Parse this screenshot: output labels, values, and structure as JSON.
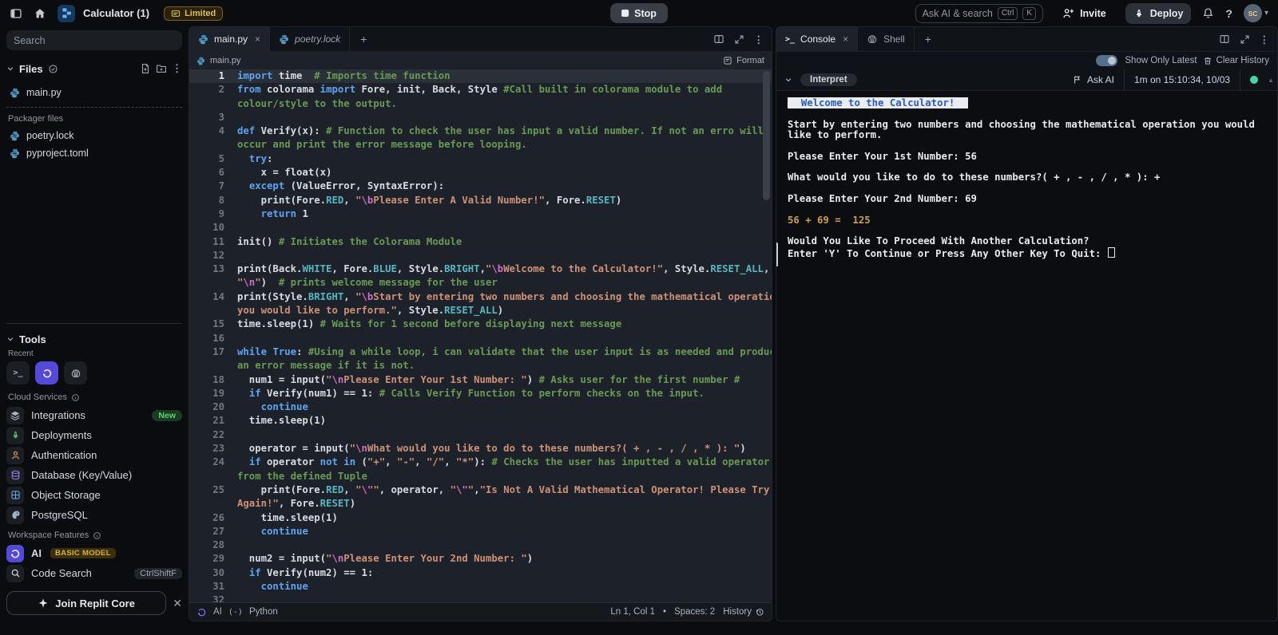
{
  "topbar": {
    "title": "Calculator (1)",
    "limited_badge": "Limited",
    "stop_label": "Stop",
    "search_placeholder": "Ask AI & search",
    "search_keys": [
      "Ctrl",
      "K"
    ],
    "invite_label": "Invite",
    "deploy_label": "Deploy",
    "avatar_initials": "SC"
  },
  "sidebar": {
    "search_placeholder": "Search",
    "files_header": "Files",
    "files": [
      {
        "icon": "python-icon",
        "name": "main.py"
      }
    ],
    "packager_label": "Packager files",
    "packager_files": [
      {
        "icon": "python-icon",
        "name": "poetry.lock"
      },
      {
        "icon": "python-icon",
        "name": "pyproject.toml"
      }
    ],
    "tools_header": "Tools",
    "recent_label": "Recent",
    "recent_tools": [
      {
        "icon": "terminal-icon",
        "active": false
      },
      {
        "icon": "ai-icon",
        "active": true
      },
      {
        "icon": "shell-icon",
        "active": false
      }
    ],
    "cloud_label": "Cloud Services",
    "cloud_items": [
      {
        "icon": "integrations-icon",
        "label": "Integrations",
        "badge": "New"
      },
      {
        "icon": "deployments-icon",
        "label": "Deployments"
      },
      {
        "icon": "authentication-icon",
        "label": "Authentication"
      },
      {
        "icon": "database-icon",
        "label": "Database (Key/Value)"
      },
      {
        "icon": "object-storage-icon",
        "label": "Object Storage"
      },
      {
        "icon": "postgresql-icon",
        "label": "PostgreSQL"
      }
    ],
    "workspace_label": "Workspace Features",
    "workspace_items": [
      {
        "icon": "ai-icon",
        "label": "AI",
        "badge": "BASIC MODEL"
      },
      {
        "icon": "code-search-icon",
        "label": "Code Search",
        "shortcut": "CtrlShiftF"
      }
    ],
    "join_core_label": "Join Replit Core"
  },
  "editor": {
    "tabs": [
      {
        "icon": "python-icon",
        "label": "main.py",
        "active": true,
        "close": true
      },
      {
        "icon": "python-icon",
        "label": "poetry.lock",
        "italic": true
      }
    ],
    "breadcrumb": "main.py",
    "format_label": "Format",
    "status": {
      "ai_label": "AI",
      "lang_glyph": "(-)",
      "language": "Python",
      "position": "Ln 1, Col 1",
      "spaces": "Spaces: 2",
      "history_label": "History"
    },
    "lines": [
      {
        "n": 1,
        "active": true,
        "segs": [
          [
            "kw",
            "import"
          ],
          [
            "pl",
            " time"
          ],
          [
            "cm",
            "  # Imports time function"
          ]
        ]
      },
      {
        "n": 2,
        "segs": [
          [
            "kw",
            "from"
          ],
          [
            "pl",
            " colorama "
          ],
          [
            "kw",
            "import"
          ],
          [
            "pl",
            " Fore, init, Back, Style "
          ],
          [
            "cm",
            "#Call built in colorama module to add"
          ]
        ]
      },
      {
        "n": null,
        "segs": [
          [
            "cm",
            "colour/style to the output."
          ]
        ]
      },
      {
        "n": 3,
        "segs": []
      },
      {
        "n": 4,
        "segs": [
          [
            "kw",
            "def"
          ],
          [
            "pl",
            " Verify(x): "
          ],
          [
            "cm",
            "# Function to check the user has input a valid number. If not an erro will"
          ]
        ]
      },
      {
        "n": null,
        "segs": [
          [
            "cm",
            "occur and print the error message before looping."
          ]
        ]
      },
      {
        "n": 5,
        "segs": [
          [
            "pl",
            "  "
          ],
          [
            "kw",
            "try"
          ],
          [
            "pl",
            ":"
          ]
        ]
      },
      {
        "n": 6,
        "segs": [
          [
            "pl",
            "    x = float(x)"
          ]
        ]
      },
      {
        "n": 7,
        "segs": [
          [
            "pl",
            "  "
          ],
          [
            "kw",
            "except"
          ],
          [
            "pl",
            " (ValueError, SyntaxError):"
          ]
        ]
      },
      {
        "n": 8,
        "segs": [
          [
            "pl",
            "    print(Fore."
          ],
          [
            "cn",
            "RED"
          ],
          [
            "pl",
            ", "
          ],
          [
            "st",
            "\""
          ],
          [
            "es",
            "\\b"
          ],
          [
            "st",
            "Please Enter A Valid Number!\""
          ],
          [
            "pl",
            ", Fore."
          ],
          [
            "cn",
            "RESET"
          ],
          [
            "pl",
            ")"
          ]
        ]
      },
      {
        "n": 9,
        "segs": [
          [
            "pl",
            "    "
          ],
          [
            "kw",
            "return"
          ],
          [
            "pl",
            " 1"
          ]
        ]
      },
      {
        "n": 10,
        "segs": []
      },
      {
        "n": 11,
        "segs": [
          [
            "pl",
            "init() "
          ],
          [
            "cm",
            "# Initiates the Colorama Module"
          ]
        ]
      },
      {
        "n": 12,
        "segs": []
      },
      {
        "n": 13,
        "segs": [
          [
            "pl",
            "print(Back."
          ],
          [
            "cn",
            "WHITE"
          ],
          [
            "pl",
            ", Fore."
          ],
          [
            "cn",
            "BLUE"
          ],
          [
            "pl",
            ", Style."
          ],
          [
            "cn",
            "BRIGHT"
          ],
          [
            "pl",
            ","
          ],
          [
            "st",
            "\""
          ],
          [
            "es",
            "\\b"
          ],
          [
            "st",
            "Welcome to the Calculator!\""
          ],
          [
            "pl",
            ", Style."
          ],
          [
            "cn",
            "RESET_ALL"
          ],
          [
            "pl",
            ","
          ]
        ]
      },
      {
        "n": null,
        "segs": [
          [
            "st",
            "\""
          ],
          [
            "es",
            "\\n"
          ],
          [
            "st",
            "\""
          ],
          [
            "pl",
            ")  "
          ],
          [
            "cm",
            "# prints welcome message for the user"
          ]
        ]
      },
      {
        "n": 14,
        "segs": [
          [
            "pl",
            "print(Style."
          ],
          [
            "cn",
            "BRIGHT"
          ],
          [
            "pl",
            ", "
          ],
          [
            "st",
            "\""
          ],
          [
            "es",
            "\\b"
          ],
          [
            "st",
            "Start by entering two numbers and choosing the mathematical operation"
          ]
        ]
      },
      {
        "n": null,
        "segs": [
          [
            "st",
            "you would like to perform.\""
          ],
          [
            "pl",
            ", Style."
          ],
          [
            "cn",
            "RESET_ALL"
          ],
          [
            "pl",
            ")"
          ]
        ]
      },
      {
        "n": 15,
        "segs": [
          [
            "pl",
            "time.sleep(1) "
          ],
          [
            "cm",
            "# Waits for 1 second before displaying next message"
          ]
        ]
      },
      {
        "n": 16,
        "segs": []
      },
      {
        "n": 17,
        "segs": [
          [
            "kw",
            "while"
          ],
          [
            "pl",
            " "
          ],
          [
            "kw",
            "True"
          ],
          [
            "pl",
            ": "
          ],
          [
            "cm",
            "#Using a while loop, i can validate that the user input is as needed and produce"
          ]
        ]
      },
      {
        "n": null,
        "segs": [
          [
            "cm",
            "an error message if it is not."
          ]
        ]
      },
      {
        "n": 18,
        "segs": [
          [
            "pl",
            "  num1 = input("
          ],
          [
            "st",
            "\""
          ],
          [
            "es",
            "\\n"
          ],
          [
            "st",
            "Please Enter Your 1st Number: \""
          ],
          [
            "pl",
            ") "
          ],
          [
            "cm",
            "# Asks user for the first number #"
          ]
        ]
      },
      {
        "n": 19,
        "segs": [
          [
            "pl",
            "  "
          ],
          [
            "kw",
            "if"
          ],
          [
            "pl",
            " Verify(num1) == 1: "
          ],
          [
            "cm",
            "# Calls Verify Function to perform checks on the input."
          ]
        ]
      },
      {
        "n": 20,
        "segs": [
          [
            "pl",
            "    "
          ],
          [
            "kw",
            "continue"
          ]
        ]
      },
      {
        "n": 21,
        "segs": [
          [
            "pl",
            "  time.sleep(1)"
          ]
        ]
      },
      {
        "n": 22,
        "segs": []
      },
      {
        "n": 23,
        "segs": [
          [
            "pl",
            "  operator = input("
          ],
          [
            "st",
            "\""
          ],
          [
            "es",
            "\\n"
          ],
          [
            "st",
            "What would you like to do to these numbers?( + , - , / , * ): \""
          ],
          [
            "pl",
            ")"
          ]
        ]
      },
      {
        "n": 24,
        "segs": [
          [
            "pl",
            "  "
          ],
          [
            "kw",
            "if"
          ],
          [
            "pl",
            " operator "
          ],
          [
            "kw",
            "not"
          ],
          [
            "pl",
            " "
          ],
          [
            "kw",
            "in"
          ],
          [
            "pl",
            " ("
          ],
          [
            "st",
            "\"+\""
          ],
          [
            "pl",
            ", "
          ],
          [
            "st",
            "\"-\""
          ],
          [
            "pl",
            ", "
          ],
          [
            "st",
            "\"/\""
          ],
          [
            "pl",
            ", "
          ],
          [
            "st",
            "\"*\""
          ],
          [
            "pl",
            "): "
          ],
          [
            "cm",
            "# Checks the user has inputted a valid operator"
          ]
        ]
      },
      {
        "n": null,
        "segs": [
          [
            "cm",
            "from the defined Tuple"
          ]
        ]
      },
      {
        "n": 25,
        "segs": [
          [
            "pl",
            "    print(Fore."
          ],
          [
            "cn",
            "RED"
          ],
          [
            "pl",
            ", "
          ],
          [
            "st",
            "\""
          ],
          [
            "es",
            "\\\""
          ],
          [
            "st",
            "\""
          ],
          [
            "pl",
            ", operator, "
          ],
          [
            "st",
            "\""
          ],
          [
            "es",
            "\\\""
          ],
          [
            "st",
            "\""
          ],
          [
            "pl",
            ","
          ],
          [
            "st",
            "\"Is Not A Valid Mathematical Operator! Please Try"
          ]
        ]
      },
      {
        "n": null,
        "segs": [
          [
            "st",
            "Again!\""
          ],
          [
            "pl",
            ", Fore."
          ],
          [
            "cn",
            "RESET"
          ],
          [
            "pl",
            ")"
          ]
        ]
      },
      {
        "n": 26,
        "segs": [
          [
            "pl",
            "    time.sleep(1)"
          ]
        ]
      },
      {
        "n": 27,
        "segs": [
          [
            "pl",
            "    "
          ],
          [
            "kw",
            "continue"
          ]
        ]
      },
      {
        "n": 28,
        "segs": []
      },
      {
        "n": 29,
        "segs": [
          [
            "pl",
            "  num2 = input("
          ],
          [
            "st",
            "\""
          ],
          [
            "es",
            "\\n"
          ],
          [
            "st",
            "Please Enter Your 2nd Number: \""
          ],
          [
            "pl",
            ")"
          ]
        ]
      },
      {
        "n": 30,
        "segs": [
          [
            "pl",
            "  "
          ],
          [
            "kw",
            "if"
          ],
          [
            "pl",
            " Verify(num2) == 1:"
          ]
        ]
      },
      {
        "n": 31,
        "segs": [
          [
            "pl",
            "    "
          ],
          [
            "kw",
            "continue"
          ]
        ]
      },
      {
        "n": 32,
        "segs": []
      }
    ]
  },
  "console": {
    "tabs": [
      {
        "icon": "terminal-icon",
        "label": "Console",
        "active": true,
        "close": true
      },
      {
        "icon": "shell-icon",
        "label": "Shell"
      }
    ],
    "show_only_latest": "Show Only Latest",
    "clear_history": "Clear History",
    "interpret_label": "Interpret",
    "ask_ai_label": "Ask AI",
    "timestamp": "1m on 15:10:34, 10/03",
    "output": [
      {
        "style": "banner",
        "text": "  Welcome to the Calculator!  "
      },
      {
        "blank": true
      },
      {
        "style": "plain",
        "text": "Start by entering two numbers and choosing the mathematical operation you would like to perform."
      },
      {
        "blank": true
      },
      {
        "style": "plain",
        "text": "Please Enter Your 1st Number: 56"
      },
      {
        "blank": true
      },
      {
        "style": "plain",
        "text": "What would you like to do to these numbers?( + , - , / , * ): +"
      },
      {
        "blank": true
      },
      {
        "style": "plain",
        "text": "Please Enter Your 2nd Number: 69"
      },
      {
        "blank": true
      },
      {
        "style": "result",
        "text": "56 + 69 =  125"
      },
      {
        "blank": true
      },
      {
        "style": "plain",
        "text": "Would You Like To Proceed With Another Calculation?"
      },
      {
        "style": "plain",
        "text": "Enter 'Y' To Continue or Press Any Other Key To Quit: ",
        "cursor": true
      }
    ]
  },
  "colors": {
    "accent_blue": "#5fa3ef",
    "banner_bg": "#e9edf2",
    "banner_text": "#2b59c9",
    "result_gold": "#cfa041",
    "run_dot": "#45d6a8",
    "toggle_on": "#54708c"
  }
}
